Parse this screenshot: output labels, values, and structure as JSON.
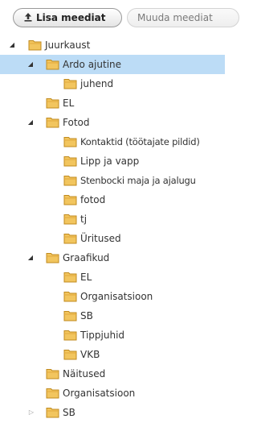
{
  "toolbar": {
    "add_media_label": "Lisa meediat",
    "edit_media_label": "Muuda meediat"
  },
  "tree": {
    "root": {
      "label": "Juurkaust"
    },
    "ardo": {
      "label": "Ardo ajutine"
    },
    "juhend": {
      "label": "juhend"
    },
    "el": {
      "label": "EL"
    },
    "fotod": {
      "label": "Fotod"
    },
    "kontaktid": {
      "label": "Kontaktid (töötajate pildid)"
    },
    "lipp": {
      "label": "Lipp ja vapp"
    },
    "stenbock": {
      "label": "Stenbocki maja ja ajalugu"
    },
    "fotod_sub": {
      "label": "fotod"
    },
    "tj": {
      "label": "tj"
    },
    "uritused": {
      "label": "Üritused"
    },
    "graafikud": {
      "label": "Graafikud"
    },
    "g_el": {
      "label": "EL"
    },
    "g_org": {
      "label": "Organisatsioon"
    },
    "g_sb": {
      "label": "SB"
    },
    "g_tipp": {
      "label": "Tippjuhid"
    },
    "g_vkb": {
      "label": "VKB"
    },
    "naitused": {
      "label": "Näitused"
    },
    "organisatsioon": {
      "label": "Organisatsioon"
    },
    "sb": {
      "label": "SB"
    }
  },
  "colors": {
    "selected_row": "#bcdcf6",
    "folder_fill": "#f2c55e",
    "folder_stroke": "#c08a1e"
  },
  "icons": {
    "upload": "upload-icon",
    "folder": "folder-icon",
    "expanded": "triangle-down-icon",
    "collapsed": "triangle-right-icon"
  }
}
